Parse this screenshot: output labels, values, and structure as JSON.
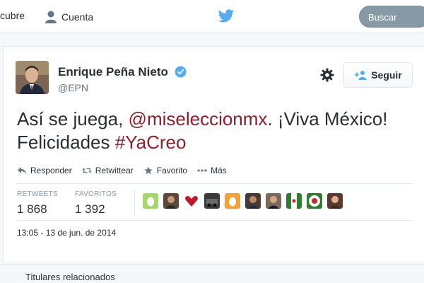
{
  "nav": {
    "descubre_label": "cubre",
    "cuenta_label": "Cuenta",
    "search_placeholder": "Buscar"
  },
  "tweet": {
    "author_name": "Enrique Peña Nieto",
    "handle": "@EPN",
    "text_intro": "Así se juega, ",
    "mention": "@miseleccionmx",
    "text_mid": ". ¡Viva México! Felicidades ",
    "hashtag": "#YaCreo",
    "follow_label": "Seguir",
    "timestamp": "13:05 - 13 de jun. de 2014"
  },
  "actions": [
    {
      "label": "Responder",
      "icon": "reply-icon"
    },
    {
      "label": "Retwittear",
      "icon": "retweet-icon"
    },
    {
      "label": "Favorito",
      "icon": "star-icon"
    },
    {
      "label": "Más",
      "icon": "more-icon"
    }
  ],
  "stats": {
    "retweets_label": "RETWEETS",
    "retweets_value": "1 868",
    "favorites_label": "FAVORITOS",
    "favorites_value": "1 392"
  },
  "footer": {
    "related_label": "Titulares relacionados"
  },
  "colors": {
    "accent": "#8e1f2c",
    "verified": "#55acee",
    "bird": "#55acee"
  }
}
